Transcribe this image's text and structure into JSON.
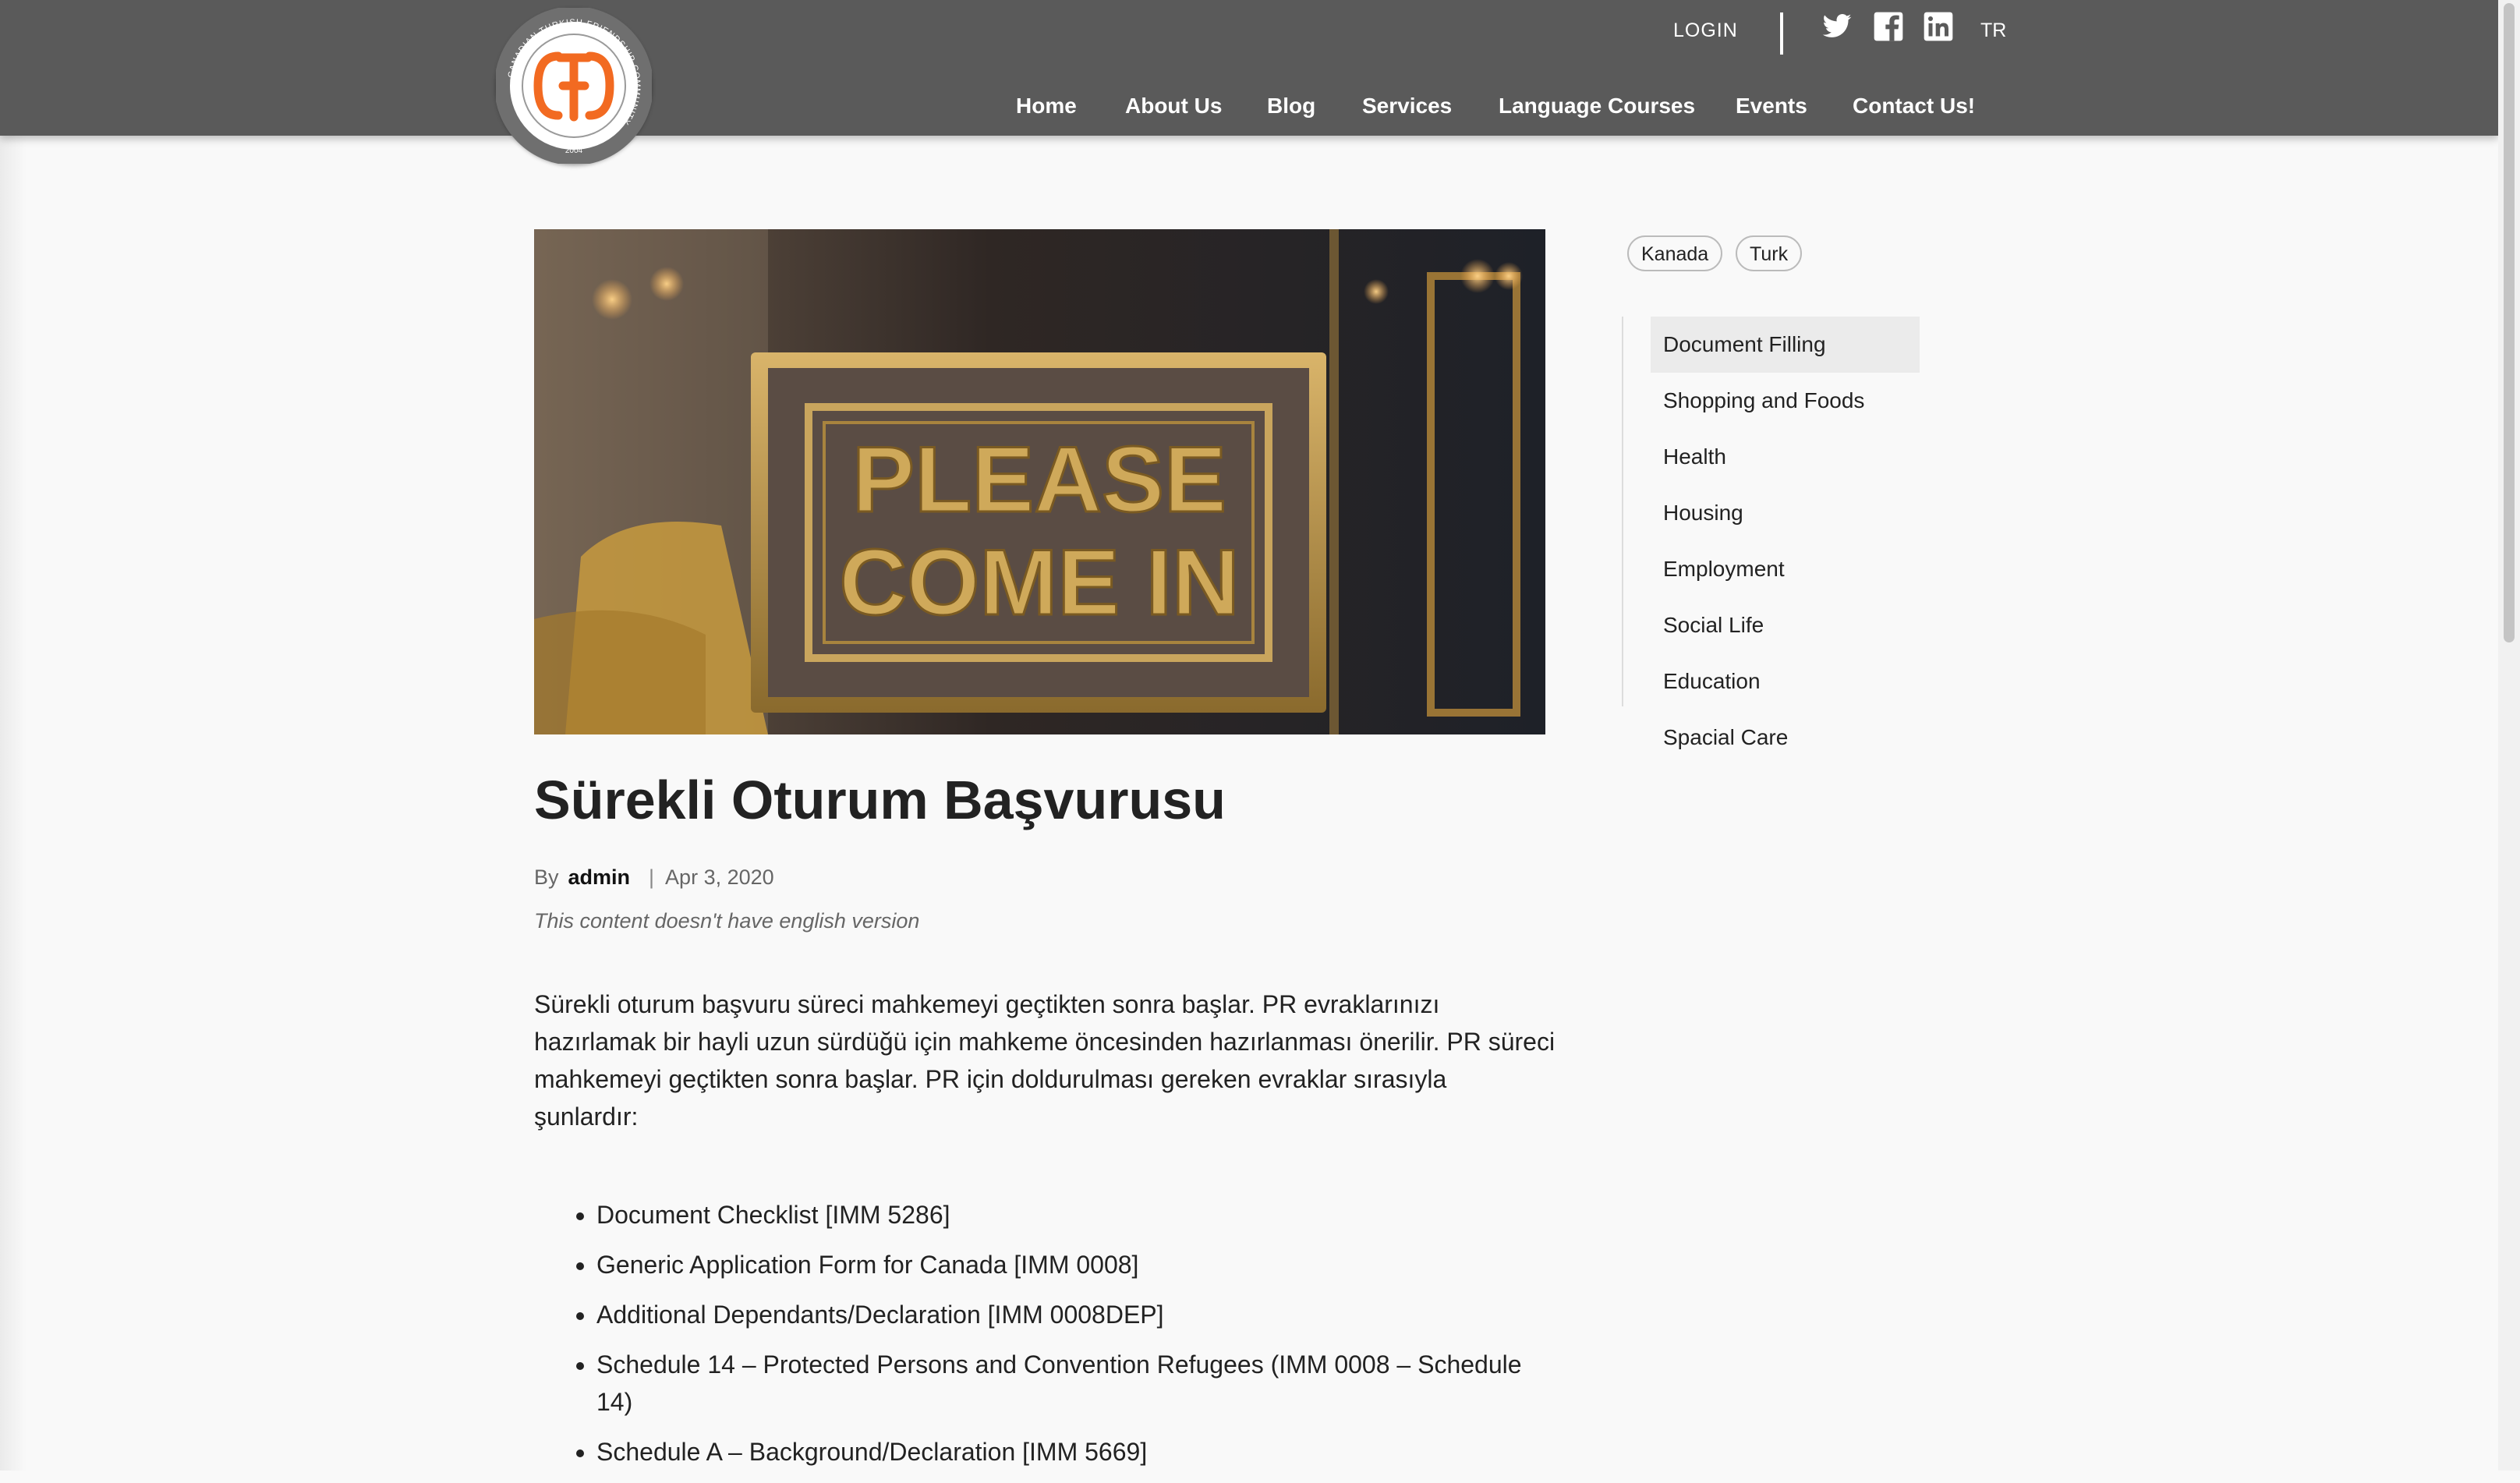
{
  "header": {
    "logo": {
      "ring_text": "CANADIAN TURKISH FRIENDSHIP COMMUNITY",
      "year": "2004",
      "brand_color": "#f26a21"
    },
    "login_label": "LOGIN",
    "social": [
      "twitter-icon",
      "facebook-icon",
      "linkedin-icon"
    ],
    "language": "TR",
    "nav": [
      "Home",
      "About Us",
      "Blog",
      "Services",
      "Language Courses",
      "Events",
      "Contact Us!"
    ]
  },
  "post": {
    "hero_sign_line1": "PLEASE",
    "hero_sign_line2": "COME IN",
    "title": "Sürekli Oturum Başvurusu",
    "by_label": "By",
    "author": "admin",
    "separator": "|",
    "date": "Apr 3, 2020",
    "note": "This content doesn't have english version",
    "paragraph": "Sürekli oturum başvuru süreci mahkemeyi geçtikten sonra başlar. PR evraklarınızı hazırlamak bir hayli uzun sürdüğü için mahkeme öncesinden hazırlanması önerilir. PR süreci mahkemeyi geçtikten sonra başlar. PR için doldurulması gereken evraklar sırasıyla şunlardır:",
    "documents": [
      "Document Checklist [IMM 5286]",
      "Generic Application Form for Canada [IMM 0008]",
      "Additional Dependants/Declaration [IMM 0008DEP]",
      "Schedule 14 – Protected Persons and Convention Refugees (IMM 0008 – Schedule 14)",
      "Schedule A – Background/Declaration [IMM 5669]"
    ]
  },
  "sidebar": {
    "tags": [
      "Kanada",
      "Turk"
    ],
    "categories": [
      "Document Filling",
      "Shopping and Foods",
      "Health",
      "Housing",
      "Employment",
      "Social Life",
      "Education",
      "Spacial Care"
    ],
    "active_category": "Document Filling"
  },
  "colors": {
    "header_bg": "#5a5a5a",
    "page_bg": "#f9f9f9",
    "active_category_bg": "#ebebeb"
  }
}
